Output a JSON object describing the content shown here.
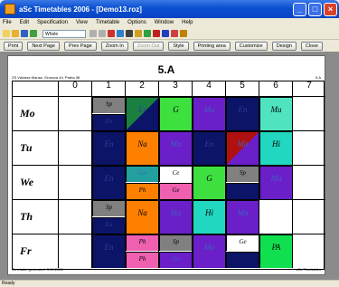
{
  "window": {
    "title": "aSc Timetables 2006 - [Demo13.roz]"
  },
  "menu": [
    "File",
    "Edit",
    "Specification",
    "View",
    "Timetable",
    "Options",
    "Window",
    "Help"
  ],
  "toolbar": {
    "view_combo": "Whole"
  },
  "buttons": {
    "print": "Print",
    "next": "Next Page",
    "prev": "Prev Page",
    "zoom_in": "Zoom In",
    "zoom_out": "Zoom Out",
    "style": "Style",
    "printing_area": "Printing area",
    "customize": "Customize",
    "design": "Design",
    "close": "Close"
  },
  "sheet": {
    "class_name": "5.A",
    "school": "ZS Václava Klause, Grosova 44, Praha 38",
    "class_small": "5.A",
    "footer_left": "Timetable generated: 3.10.2006",
    "footer_right": "aSc Timetables"
  },
  "periods": [
    "0",
    "1",
    "2",
    "3",
    "4",
    "5",
    "6",
    "7"
  ],
  "days": [
    "Mo",
    "Tu",
    "We",
    "Th",
    "Fr"
  ],
  "colors": {
    "na": "#ff8000",
    "ma": "#6a1fc8",
    "g": "#3ee040",
    "hi": "#22d7c0",
    "mu": "#4fe3c0",
    "ph": "#f060b0",
    "ce": "#ffffff",
    "sp": "#808080",
    "en": "#0b1466",
    "pe": "#10e050"
  },
  "cells": [
    {
      "d": 0,
      "p": 1,
      "s": "Sp",
      "c": "#808080",
      "h": "half"
    },
    {
      "d": 0,
      "p": 1,
      "s": "En",
      "c": "#0b1466",
      "h": "bottom"
    },
    {
      "d": 0,
      "p": 2,
      "s": "Er",
      "c": "#0b1466",
      "diag": "#1a8040"
    },
    {
      "d": 0,
      "p": 3,
      "s": "G",
      "c": "#3ee040"
    },
    {
      "d": 0,
      "p": 4,
      "s": "Ma",
      "c": "#6a1fc8"
    },
    {
      "d": 0,
      "p": 5,
      "s": "En",
      "c": "#0b1466"
    },
    {
      "d": 0,
      "p": 6,
      "s": "Mu",
      "c": "#4fe3c0"
    },
    {
      "d": 1,
      "p": 1,
      "s": "En",
      "c": "#0b1466"
    },
    {
      "d": 1,
      "p": 2,
      "s": "Na",
      "c": "#ff8000"
    },
    {
      "d": 1,
      "p": 3,
      "s": "Ma",
      "c": "#6a1fc8"
    },
    {
      "d": 1,
      "p": 4,
      "s": "En",
      "c": "#0b1466"
    },
    {
      "d": 1,
      "p": 5,
      "s": "Ma",
      "c": "#6a1fc8",
      "diag": "#b01010"
    },
    {
      "d": 1,
      "p": 6,
      "s": "Hi",
      "c": "#22d7c0"
    },
    {
      "d": 2,
      "p": 1,
      "s": "En",
      "c": "#0b1466"
    },
    {
      "d": 2,
      "p": 2,
      "s": "Ge",
      "c": "#22a0a0",
      "h": "half"
    },
    {
      "d": 2,
      "p": 2,
      "s": "Ph",
      "c": "#ff8000",
      "h": "bottom"
    },
    {
      "d": 2,
      "p": 3,
      "s": "Ce",
      "c": "#ffffff",
      "h": "half"
    },
    {
      "d": 2,
      "p": 3,
      "s": "Ge",
      "c": "#f060b0",
      "h": "bottom"
    },
    {
      "d": 2,
      "p": 4,
      "s": "G",
      "c": "#3ee040"
    },
    {
      "d": 2,
      "p": 5,
      "s": "Sp",
      "c": "#808080",
      "h": "half"
    },
    {
      "d": 2,
      "p": 5,
      "s": "",
      "c": "#0b1466",
      "h": "bottom"
    },
    {
      "d": 2,
      "p": 6,
      "s": "Ma",
      "c": "#6a1fc8"
    },
    {
      "d": 3,
      "p": 1,
      "s": "Sp",
      "c": "#808080",
      "h": "half"
    },
    {
      "d": 3,
      "p": 1,
      "s": "En",
      "c": "#0b1466",
      "h": "bottom"
    },
    {
      "d": 3,
      "p": 2,
      "s": "Na",
      "c": "#ff8000"
    },
    {
      "d": 3,
      "p": 3,
      "s": "Ma",
      "c": "#6a1fc8"
    },
    {
      "d": 3,
      "p": 4,
      "s": "Hi",
      "c": "#22d7c0"
    },
    {
      "d": 3,
      "p": 5,
      "s": "Ma",
      "c": "#6a1fc8"
    },
    {
      "d": 4,
      "p": 1,
      "s": "En",
      "c": "#0b1466"
    },
    {
      "d": 4,
      "p": 2,
      "s": "Ph",
      "c": "#f060b0",
      "h": "half"
    },
    {
      "d": 4,
      "p": 2,
      "s": "Ph",
      "c": "#f060b0",
      "h": "bottom"
    },
    {
      "d": 4,
      "p": 3,
      "s": "Sp",
      "c": "#808080",
      "h": "half"
    },
    {
      "d": 4,
      "p": 3,
      "s": "Ge",
      "c": "#6a1fc8",
      "h": "bottom"
    },
    {
      "d": 4,
      "p": 4,
      "s": "Ma",
      "c": "#6a1fc8"
    },
    {
      "d": 4,
      "p": 5,
      "s": "Ge",
      "c": "#ffffff",
      "h": "half"
    },
    {
      "d": 4,
      "p": 5,
      "s": "",
      "c": "#0b1466",
      "h": "bottom"
    },
    {
      "d": 4,
      "p": 6,
      "s": "PA",
      "c": "#10e050"
    }
  ],
  "status": "Ready"
}
